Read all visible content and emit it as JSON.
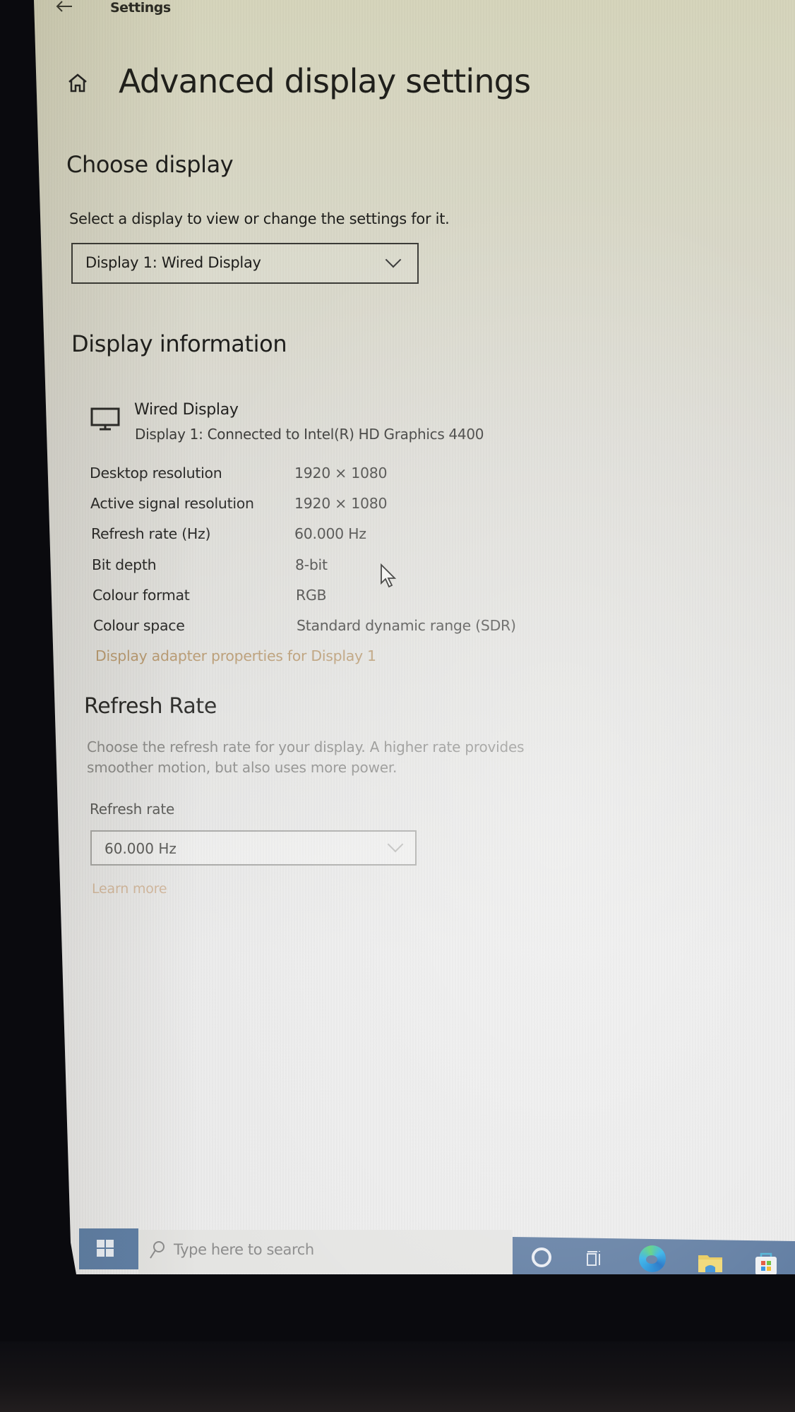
{
  "window": {
    "app_title": "Settings",
    "back_icon": "back-arrow-icon"
  },
  "page": {
    "title": "Advanced display settings",
    "home_icon": "home-icon"
  },
  "choose_display": {
    "heading": "Choose display",
    "description": "Select a display to view or change the settings for it.",
    "dropdown_value": "Display 1: Wired Display"
  },
  "display_information": {
    "heading": "Display information",
    "monitor_icon": "monitor-icon",
    "monitor_name": "Wired Display",
    "monitor_subtitle": "Display 1: Connected to Intel(R) HD Graphics 4400",
    "rows": [
      {
        "label": "Desktop resolution",
        "value": "1920 × 1080"
      },
      {
        "label": "Active signal resolution",
        "value": "1920 × 1080"
      },
      {
        "label": "Refresh rate (Hz)",
        "value": "60.000 Hz"
      },
      {
        "label": "Bit depth",
        "value": "8-bit"
      },
      {
        "label": "Colour format",
        "value": "RGB"
      },
      {
        "label": "Colour space",
        "value": "Standard dynamic range (SDR)"
      }
    ],
    "adapter_link": "Display adapter properties for Display 1"
  },
  "refresh_rate": {
    "heading": "Refresh Rate",
    "description": "Choose the refresh rate for your display. A higher rate provides smoother motion, but also uses more power.",
    "field_label": "Refresh rate",
    "dropdown_value": "60.000 Hz",
    "learn_more": "Learn more"
  },
  "taskbar": {
    "search_placeholder": "Type here to search",
    "icons": [
      "start-icon",
      "search-icon",
      "cortana-icon",
      "task-view-icon",
      "edge-icon",
      "file-explorer-icon",
      "store-icon"
    ]
  },
  "colors": {
    "link": "#b89a72",
    "taskbar": "#5d7aa0",
    "text_primary": "#1f1f1b",
    "text_secondary": "#8a8a88"
  }
}
